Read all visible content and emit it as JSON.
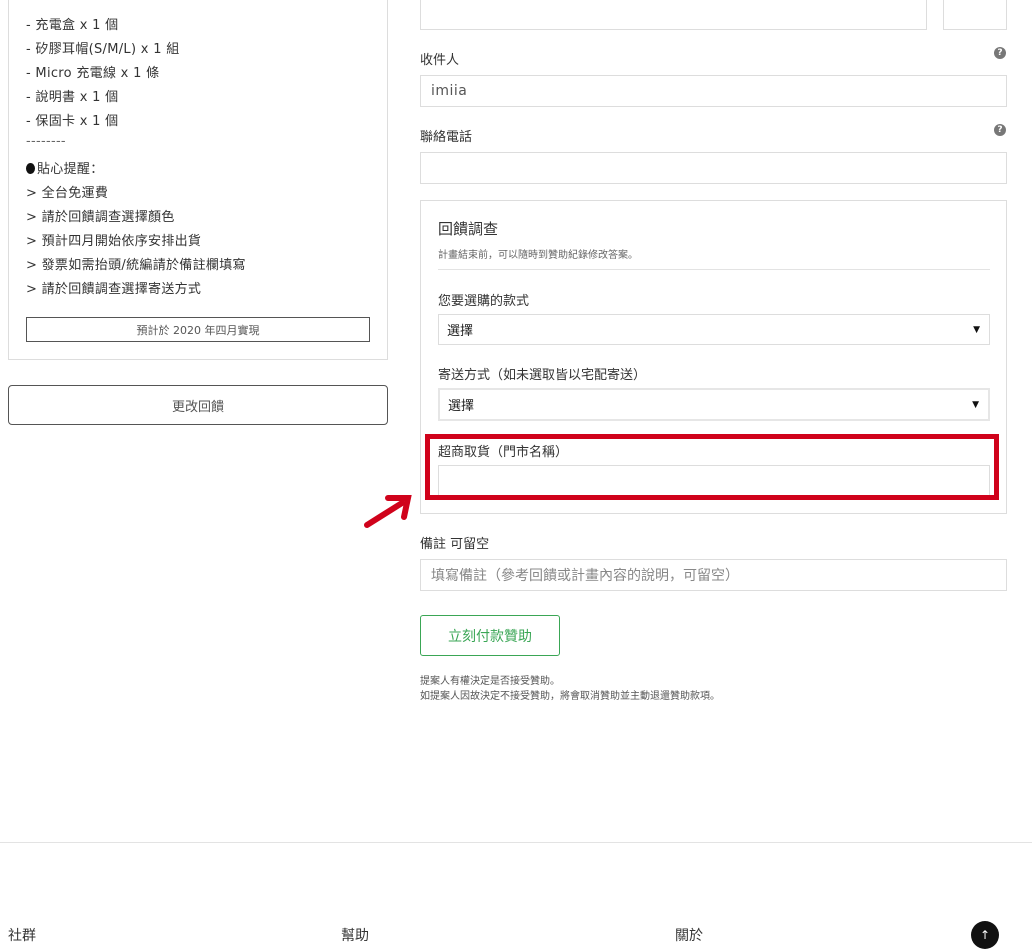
{
  "reward": {
    "items": [
      "- 充電盒 x 1 個",
      "- 矽膠耳帽(S/M/L) x 1 組",
      "- Micro 充電線 x 1 條",
      "- 說明書 x 1 個",
      "- 保固卡 x 1 個",
      "--------"
    ],
    "tips_title": "貼心提醒：",
    "tips": [
      "> 全台免運費",
      "> 請於回饋調查選擇顏色",
      "> 預計四月開始依序安排出貨",
      "> 發票如需抬頭/統編請於備註欄填寫",
      "> 請於回饋調查選擇寄送方式"
    ],
    "estimate": "預計於 2020 年四月實現",
    "change_label": "更改回饋"
  },
  "form": {
    "recipient_label": "收件人",
    "recipient_value": "imiia",
    "phone_label": "聯絡電話",
    "phone_value": "",
    "help_glyph": "?"
  },
  "survey": {
    "title": "回饋調查",
    "subtitle": "計畫結束前，可以隨時到贊助紀錄修改答案。",
    "style_label": "您要選購的款式",
    "style_value": "選擇",
    "shipping_label": "寄送方式（如未選取皆以宅配寄送）",
    "shipping_value": "選擇",
    "store_label": "超商取貨（門市名稱）",
    "store_value": ""
  },
  "remarks": {
    "label": "備註 可留空",
    "placeholder": "填寫備註（參考回饋或計畫內容的說明，可留空）"
  },
  "pay_label": "立刻付款贊助",
  "notes": [
    "提案人有權決定是否接受贊助。",
    "如提案人因故決定不接受贊助，將會取消贊助並主動退還贊助款項。"
  ],
  "footer": {
    "col1": "社群",
    "col2": "幫助",
    "col3": "關於"
  },
  "colors": {
    "accent_green": "#3aa655",
    "highlight_red": "#d0021b"
  }
}
